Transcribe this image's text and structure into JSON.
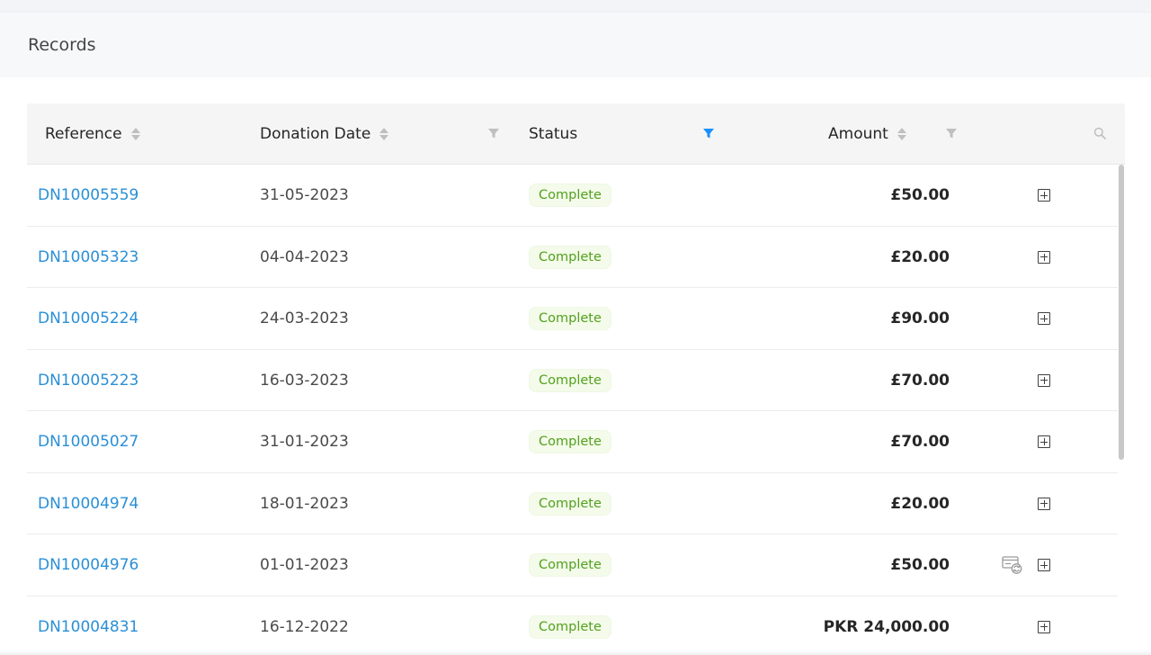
{
  "page": {
    "title": "Records"
  },
  "table": {
    "columns": {
      "reference": "Reference",
      "donation_date": "Donation Date",
      "status": "Status",
      "amount": "Amount"
    },
    "status_filter_active_color": "#1890ff",
    "icons": {
      "sort": "sort-icon",
      "filter": "filter-icon",
      "search": "search-icon",
      "expand": "plus-square-icon",
      "recurring": "recurring-payment-icon"
    },
    "rows": [
      {
        "reference": "DN10005559",
        "date": "31-05-2023",
        "status": "Complete",
        "amount": "£50.00",
        "recurring": false
      },
      {
        "reference": "DN10005323",
        "date": "04-04-2023",
        "status": "Complete",
        "amount": "£20.00",
        "recurring": false
      },
      {
        "reference": "DN10005224",
        "date": "24-03-2023",
        "status": "Complete",
        "amount": "£90.00",
        "recurring": false
      },
      {
        "reference": "DN10005223",
        "date": "16-03-2023",
        "status": "Complete",
        "amount": "£70.00",
        "recurring": false
      },
      {
        "reference": "DN10005027",
        "date": "31-01-2023",
        "status": "Complete",
        "amount": "£70.00",
        "recurring": false
      },
      {
        "reference": "DN10004974",
        "date": "18-01-2023",
        "status": "Complete",
        "amount": "£20.00",
        "recurring": false
      },
      {
        "reference": "DN10004976",
        "date": "01-01-2023",
        "status": "Complete",
        "amount": "£50.00",
        "recurring": true
      },
      {
        "reference": "DN10004831",
        "date": "16-12-2022",
        "status": "Complete",
        "amount": "PKR 24,000.00",
        "recurring": false
      }
    ]
  }
}
